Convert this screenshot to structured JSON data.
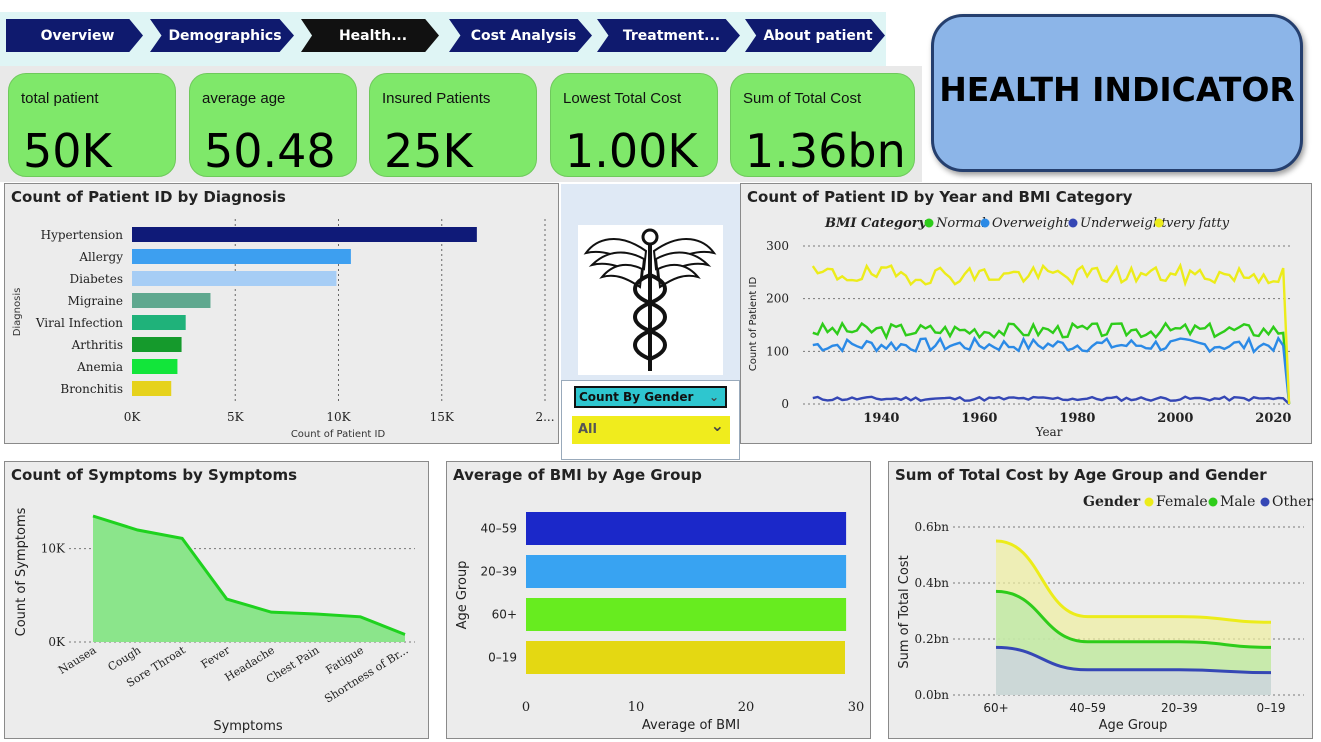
{
  "nav": {
    "tabs": [
      {
        "label": "Overview",
        "color": "#0f1a6e"
      },
      {
        "label": "Demographics",
        "color": "#0f1a6e"
      },
      {
        "label": "Health...",
        "color": "#111111"
      },
      {
        "label": "Cost Analysis",
        "color": "#0f1a6e"
      },
      {
        "label": "Treatment...",
        "color": "#0f1a6e"
      },
      {
        "label": "About patient",
        "color": "#0f1a6e"
      }
    ]
  },
  "kpis": [
    {
      "label": "total patient",
      "value": "50K"
    },
    {
      "label": "average age",
      "value": "50.48"
    },
    {
      "label": "Insured Patients",
      "value": "25K"
    },
    {
      "label": "Lowest Total Cost",
      "value": "1.00K"
    },
    {
      "label": "Sum of Total Cost",
      "value": "1.36bn"
    }
  ],
  "header": {
    "title": "HEALTH INDICATOR"
  },
  "slicer": {
    "title": "Count By Gender",
    "value": "All"
  },
  "icon": {
    "name": "caduceus-icon"
  },
  "charts": {
    "diagnosis": {
      "title": "Count of Patient ID by Diagnosis",
      "chart_data": {
        "type": "bar",
        "orientation": "horizontal",
        "categories": [
          "Hypertension",
          "Allergy",
          "Diabetes",
          "Migraine",
          "Viral Infection",
          "Arthritis",
          "Anemia",
          "Bronchitis"
        ],
        "values": [
          16700,
          10600,
          9900,
          3800,
          2600,
          2400,
          2200,
          1900
        ],
        "colors": [
          "#0f1a78",
          "#3d9ff0",
          "#a6cdf5",
          "#5fa88f",
          "#1fb27a",
          "#159a2c",
          "#12e53a",
          "#e6d21c"
        ],
        "xlabel": "Count of Patient ID",
        "ylabel": "Diagnosis",
        "xticks": [
          "0K",
          "5K",
          "10K",
          "15K",
          "2..."
        ],
        "xlim": [
          0,
          20000
        ]
      }
    },
    "bmi_year": {
      "title": "Count of Patient ID by Year and BMI Category",
      "legend_title": "BMI Category",
      "chart_data": {
        "type": "line",
        "xlabel": "Year",
        "ylabel": "Count of Patient ID",
        "xlim": [
          1924,
          2024
        ],
        "ylim": [
          0,
          300
        ],
        "xticks": [
          "1940",
          "1960",
          "1980",
          "2000",
          "2020"
        ],
        "yticks": [
          "0",
          "100",
          "200",
          "300"
        ],
        "legend": "top",
        "series": [
          {
            "name": "Normal",
            "color": "#2ecc1a",
            "mean": 140,
            "amp": 14,
            "seed": 3
          },
          {
            "name": "Overweight",
            "color": "#2b8ae6",
            "mean": 112,
            "amp": 13,
            "seed": 7
          },
          {
            "name": "Underweight",
            "color": "#3547b5",
            "mean": 10,
            "amp": 4,
            "seed": 11
          },
          {
            "name": "very fatty",
            "color": "#ecec1a",
            "mean": 245,
            "amp": 18,
            "seed": 19
          }
        ]
      }
    },
    "symptoms": {
      "title": "Count of Symptoms by Symptoms",
      "chart_data": {
        "type": "area",
        "categories": [
          "Nausea",
          "Cough",
          "Sore Throat",
          "Fever",
          "Headache",
          "Chest Pain",
          "Fatigue",
          "Shortness of Br..."
        ],
        "values": [
          13500,
          12000,
          11100,
          4600,
          3200,
          3000,
          2700,
          800
        ],
        "xlabel": "Symptoms",
        "ylabel": "Count of Symptoms",
        "yticks": [
          "0K",
          "10K"
        ],
        "ylim": [
          0,
          15000
        ],
        "color": "#1fd21f",
        "fill": "#8be58b"
      }
    },
    "bmi_age": {
      "title": "Average of BMI by Age Group",
      "chart_data": {
        "type": "bar",
        "orientation": "horizontal",
        "categories": [
          "40–59",
          "20–39",
          "60+",
          "0–19"
        ],
        "values": [
          29.1,
          29.1,
          29.1,
          29.0
        ],
        "colors": [
          "#1b28c9",
          "#38a3f2",
          "#67ec1f",
          "#e4d812"
        ],
        "xlabel": "Average of BMI",
        "ylabel": "Age Group",
        "xticks": [
          "0",
          "10",
          "20",
          "30"
        ],
        "xlim": [
          0,
          30
        ]
      }
    },
    "cost_age": {
      "title": "Sum of Total Cost by Age Group and Gender",
      "legend_title": "Gender",
      "chart_data": {
        "type": "area",
        "categories": [
          "60+",
          "40–59",
          "20–39",
          "0–19"
        ],
        "xlabel": "Age Group",
        "ylabel": "Sum of Total Cost",
        "yticks": [
          "0.0bn",
          "0.2bn",
          "0.4bn",
          "0.6bn"
        ],
        "ylim": [
          0,
          0.6
        ],
        "series": [
          {
            "name": "Female",
            "color": "#ecec1a",
            "fill": "#efefa0",
            "values": [
              0.55,
              0.28,
              0.28,
              0.26
            ]
          },
          {
            "name": "Male",
            "color": "#2ecc1a",
            "fill": "#b8e8a8",
            "values": [
              0.37,
              0.19,
              0.19,
              0.17
            ]
          },
          {
            "name": "Other",
            "color": "#3547b5",
            "fill": "#cdd0ea",
            "values": [
              0.17,
              0.09,
              0.09,
              0.08
            ]
          }
        ]
      }
    }
  }
}
